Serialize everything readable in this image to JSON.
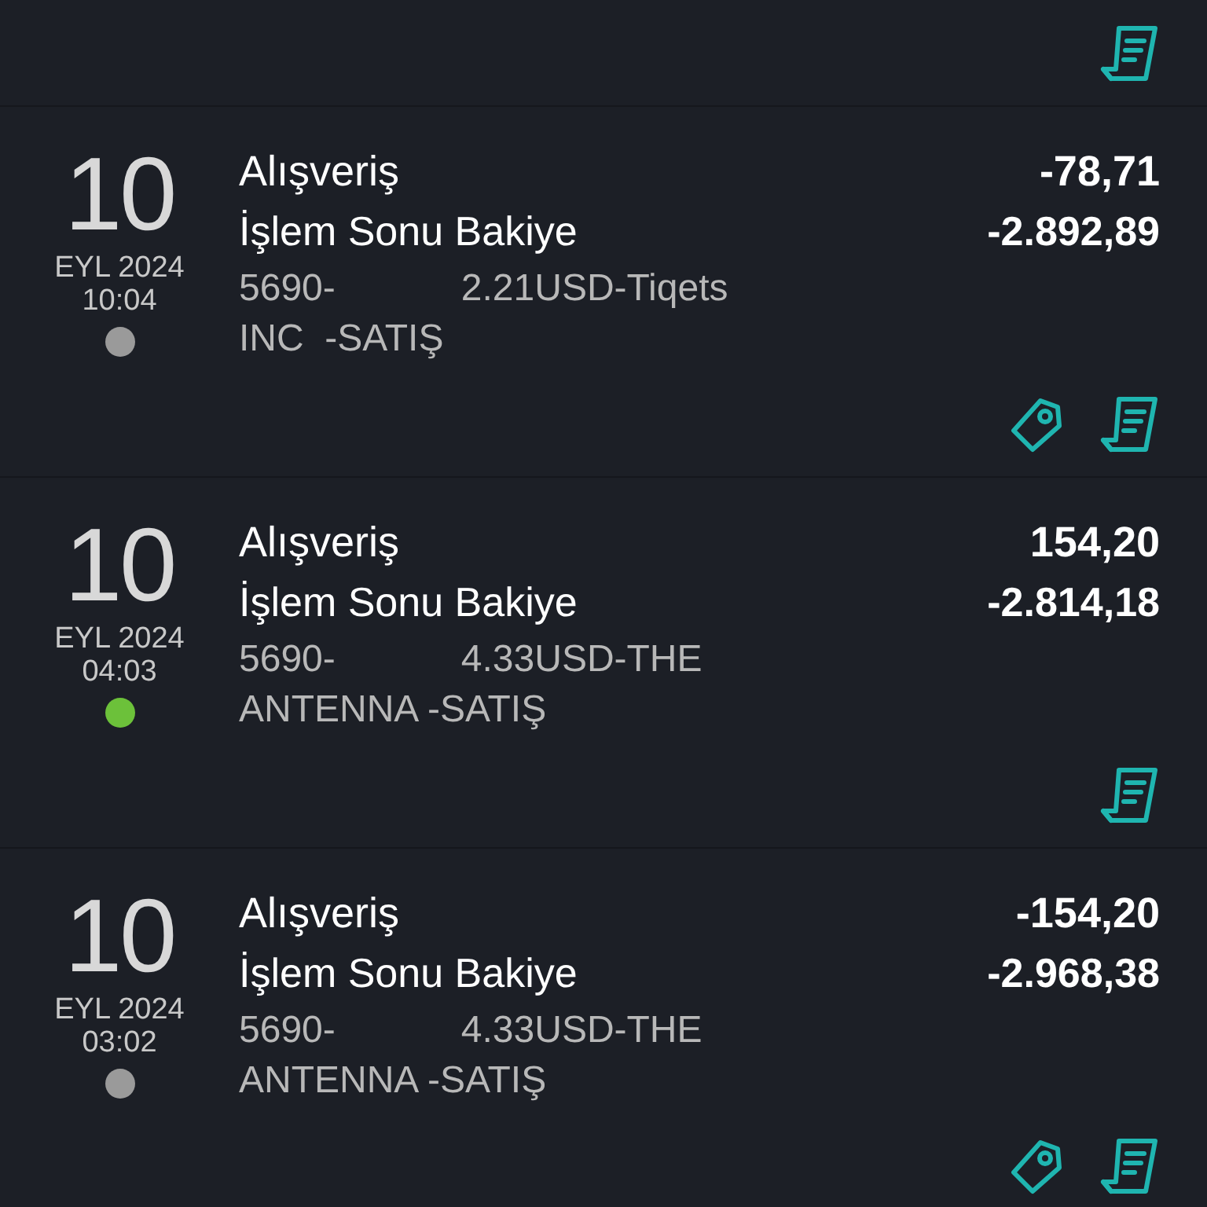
{
  "top_partial_row": {
    "has_tag": false,
    "has_receipt": true
  },
  "transactions": [
    {
      "day": "10",
      "month_year": "EYL 2024",
      "time": "10:04",
      "color": "#9a9a9a",
      "title": "Alışveriş",
      "balance_label": "İşlem Sonu Bakiye",
      "description_lines": [
        "5690-            2.21USD-Tiqets",
        "INC  -SATIŞ"
      ],
      "amount": "-78,71",
      "balance": "-2.892,89",
      "has_tag": true,
      "has_receipt": true
    },
    {
      "day": "10",
      "month_year": "EYL 2024",
      "time": "04:03",
      "color": "#6cc13a",
      "title": "Alışveriş",
      "balance_label": "İşlem Sonu Bakiye",
      "description_lines": [
        "5690-            4.33USD-THE",
        "ANTENNA -SATIŞ"
      ],
      "amount": "154,20",
      "balance": "-2.814,18",
      "has_tag": false,
      "has_receipt": true
    },
    {
      "day": "10",
      "month_year": "EYL 2024",
      "time": "03:02",
      "color": "#9a9a9a",
      "title": "Alışveriş",
      "balance_label": "İşlem Sonu Bakiye",
      "description_lines": [
        "5690-            4.33USD-THE",
        "ANTENNA -SATIŞ"
      ],
      "amount": "-154,20",
      "balance": "-2.968,38",
      "has_tag": true,
      "has_receipt": true
    }
  ]
}
